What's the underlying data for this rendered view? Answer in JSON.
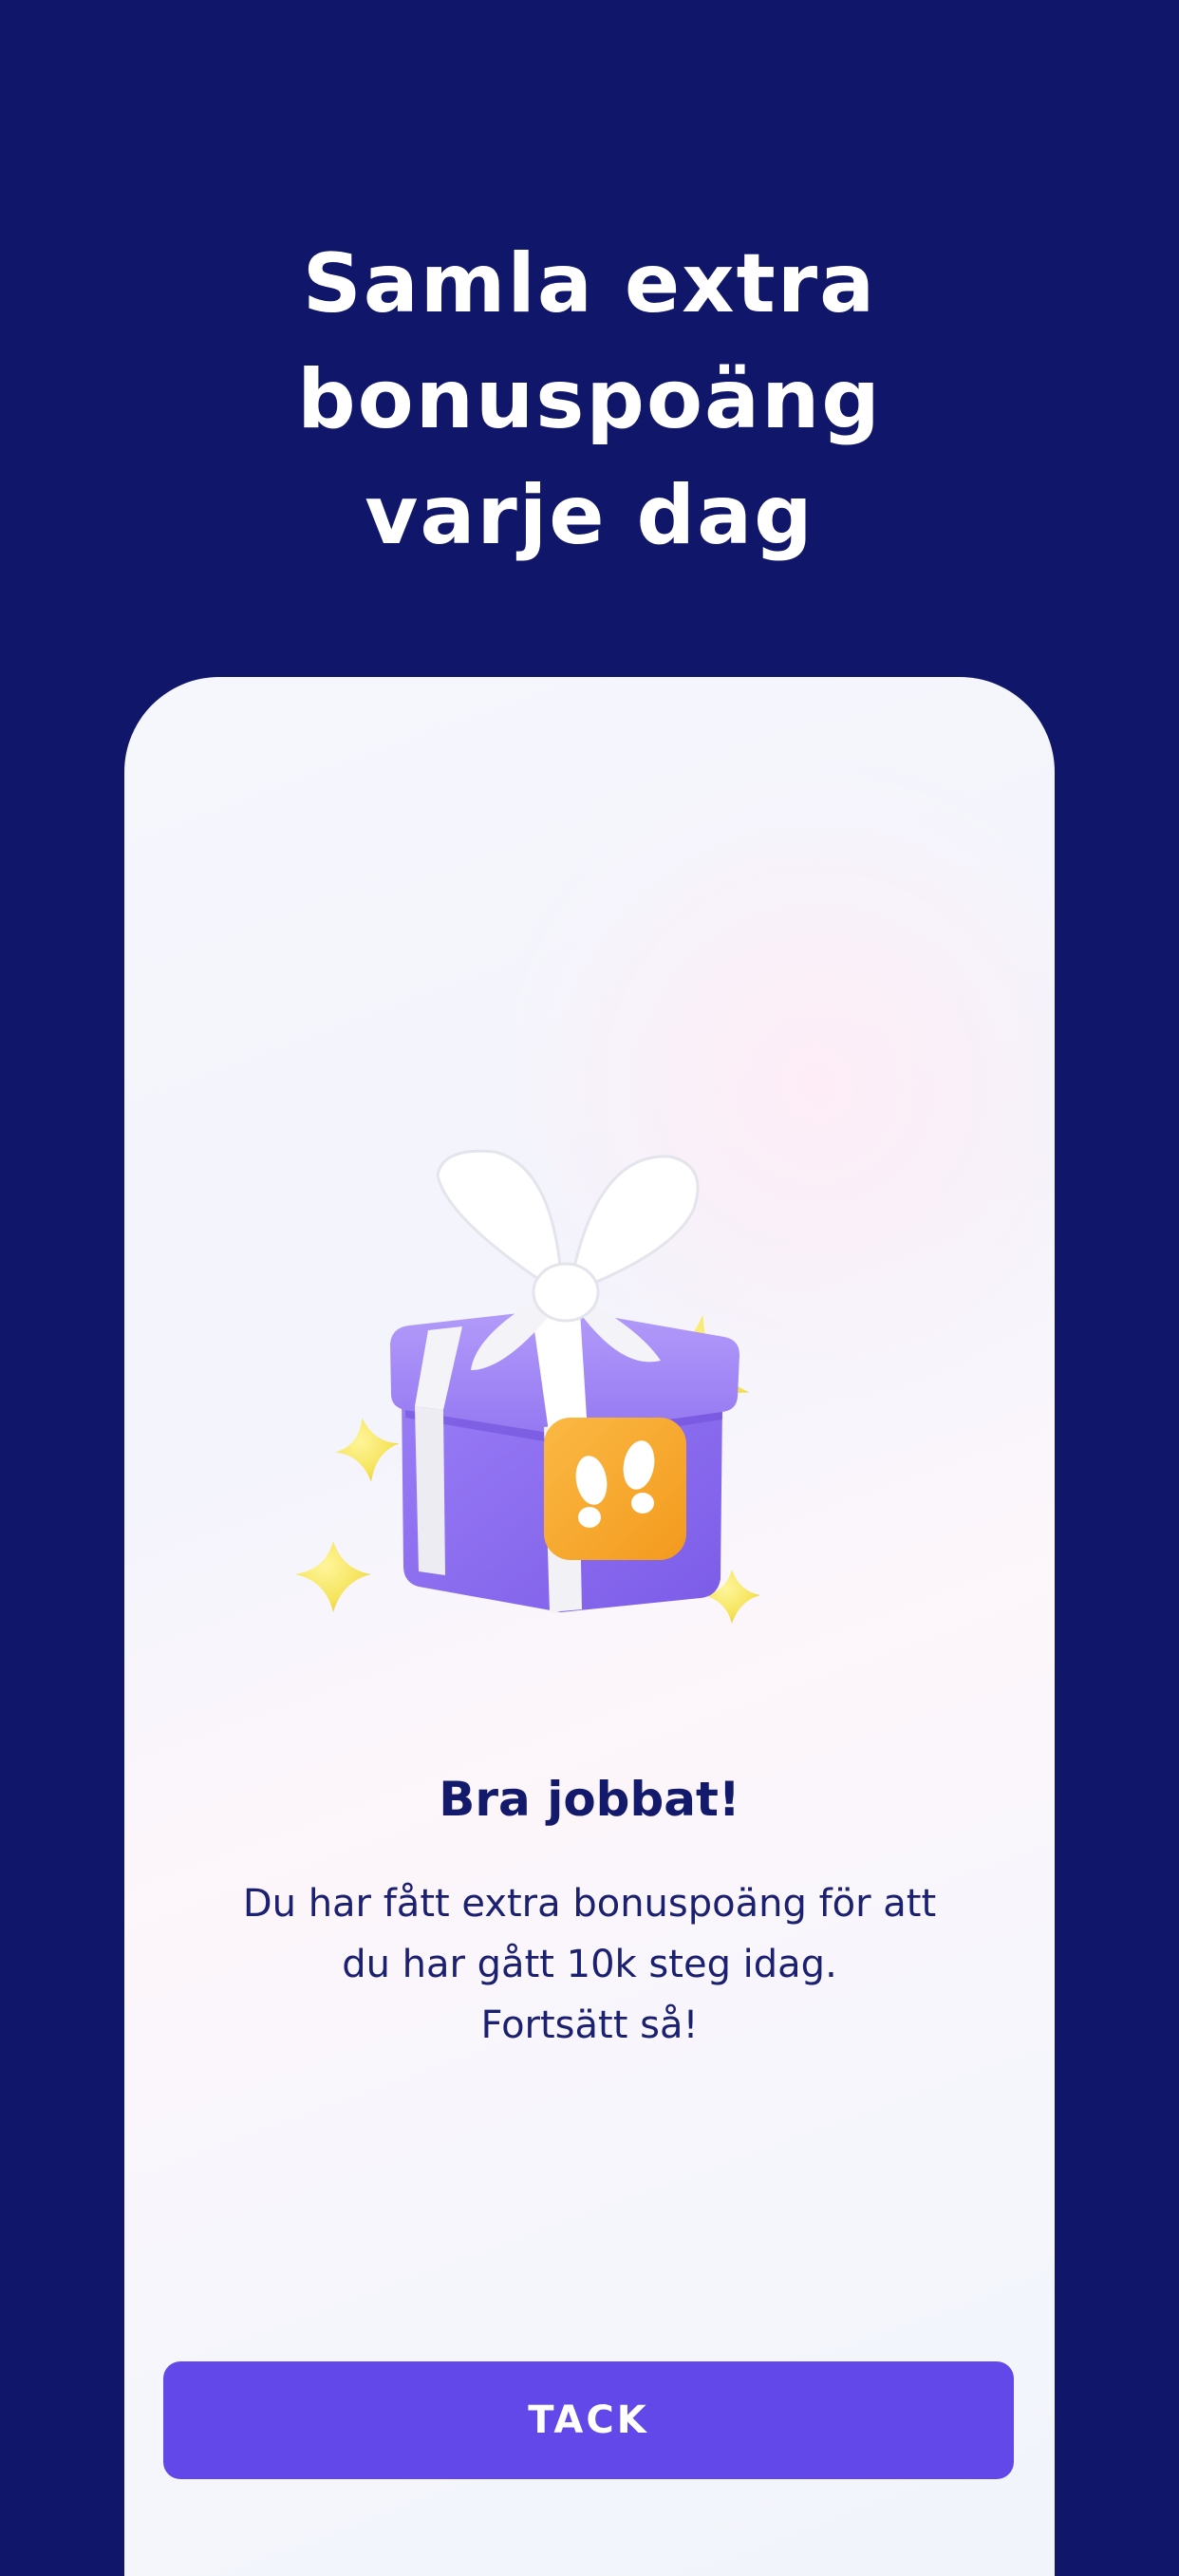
{
  "header": {
    "headline_line1": "Samla extra bonuspoäng",
    "headline_line2": "varje dag"
  },
  "card": {
    "illustration": "gift-box-with-steps-badge",
    "title": "Bra jobbat!",
    "body_line1": "Du har fått extra bonuspoäng för att",
    "body_line2": "du har gått 10k steg idag.",
    "body_line3": "Fortsätt så!",
    "button_label": "TACK"
  },
  "colors": {
    "background": "#10166a",
    "accent": "#6248e8",
    "gift_box": "#8b6cf0",
    "badge": "#f6a623",
    "stars": "#f5e35a"
  }
}
